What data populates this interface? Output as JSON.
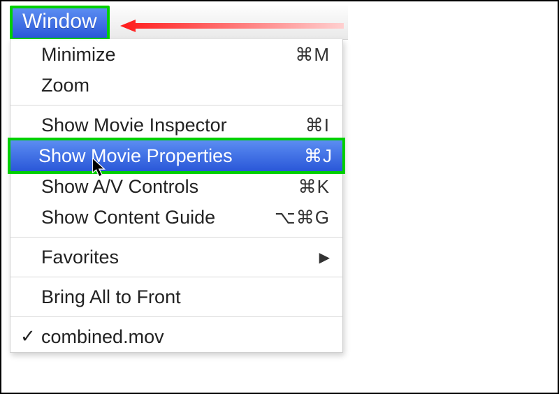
{
  "menubar": {
    "title": "Window"
  },
  "menu": {
    "items": [
      {
        "label": "Minimize",
        "shortcut": "⌘M"
      },
      {
        "label": "Zoom",
        "shortcut": ""
      }
    ],
    "items2": [
      {
        "label": "Show Movie Inspector",
        "shortcut": "⌘I"
      },
      {
        "label": "Show Movie Properties",
        "shortcut": "⌘J",
        "highlighted": true
      },
      {
        "label": "Show A/V Controls",
        "shortcut": "⌘K"
      },
      {
        "label": "Show Content Guide",
        "shortcut": "⌥⌘G"
      }
    ],
    "favorites": {
      "label": "Favorites"
    },
    "bring": {
      "label": "Bring All to Front"
    },
    "window_item": {
      "label": "combined.mov",
      "checked": true
    }
  }
}
